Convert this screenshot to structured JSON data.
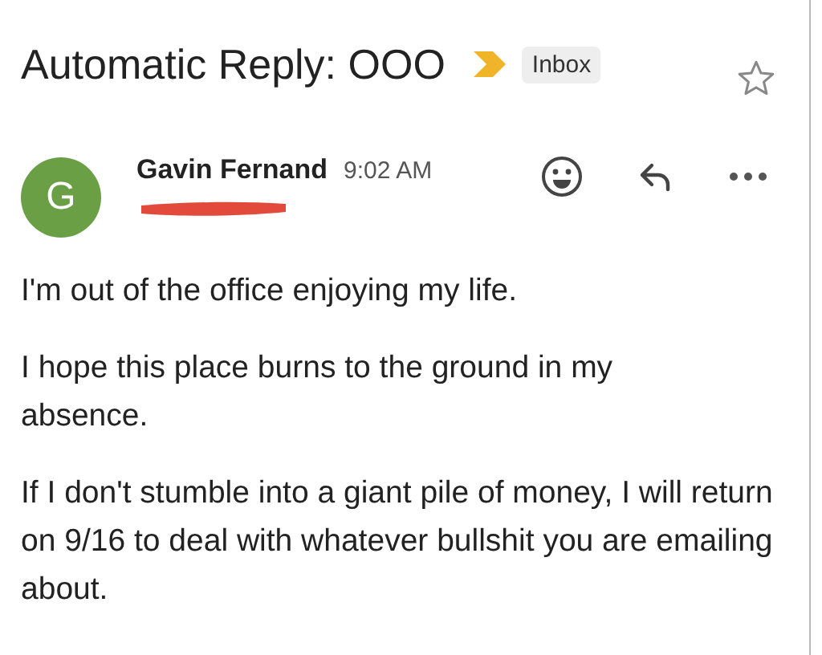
{
  "subject": "Automatic Reply: OOO",
  "important": true,
  "label": "Inbox",
  "starred": false,
  "message": {
    "avatar_letter": "G",
    "color": "#6a9f45",
    "sender": "Gavin Fernand",
    "time": "9:02 AM",
    "recipient_redacted": true
  },
  "body": [
    "I'm out of the office enjoying my life.",
    "I hope this place burns to the ground in my absence.",
    "If I don't stumble into a giant pile of money, I will return on 9/16 to deal with whatever bullshit you are emailing about."
  ]
}
